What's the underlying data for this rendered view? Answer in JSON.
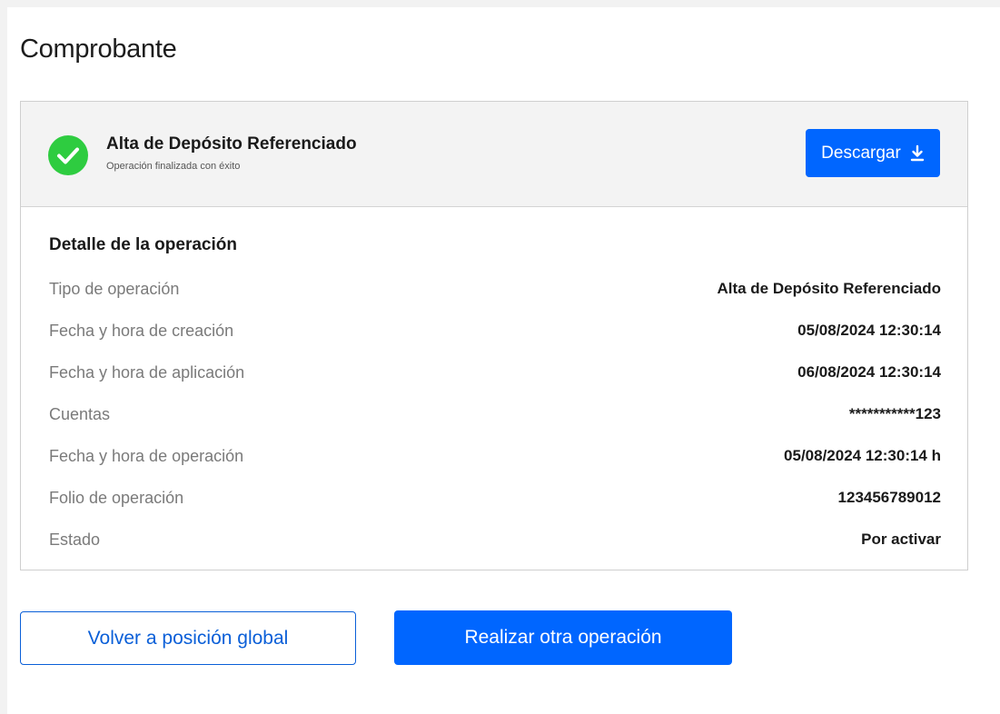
{
  "page": {
    "title": "Comprobante"
  },
  "receipt": {
    "title": "Alta de Depósito Referenciado",
    "subtitle": "Operación finalizada con éxito",
    "download_label": "Descargar",
    "success_color": "#2ecc40",
    "accent_color": "#0066ff",
    "status_icon": "check-circle-icon",
    "download_icon": "download-icon"
  },
  "details": {
    "title": "Detalle de la operación",
    "rows": [
      {
        "label": "Tipo de operación",
        "value": "Alta de Depósito Referenciado"
      },
      {
        "label": "Fecha y hora de creación",
        "value": "05/08/2024 12:30:14"
      },
      {
        "label": "Fecha y hora de aplicación",
        "value": "06/08/2024 12:30:14"
      },
      {
        "label": "Cuentas",
        "value": "***********123"
      },
      {
        "label": "Fecha y hora de operación",
        "value": "05/08/2024 12:30:14 h"
      },
      {
        "label": "Folio de operación",
        "value": "123456789012"
      },
      {
        "label": "Estado",
        "value": "Por activar"
      }
    ]
  },
  "actions": {
    "back_label": "Volver a posición global",
    "other_label": "Realizar otra operación"
  }
}
